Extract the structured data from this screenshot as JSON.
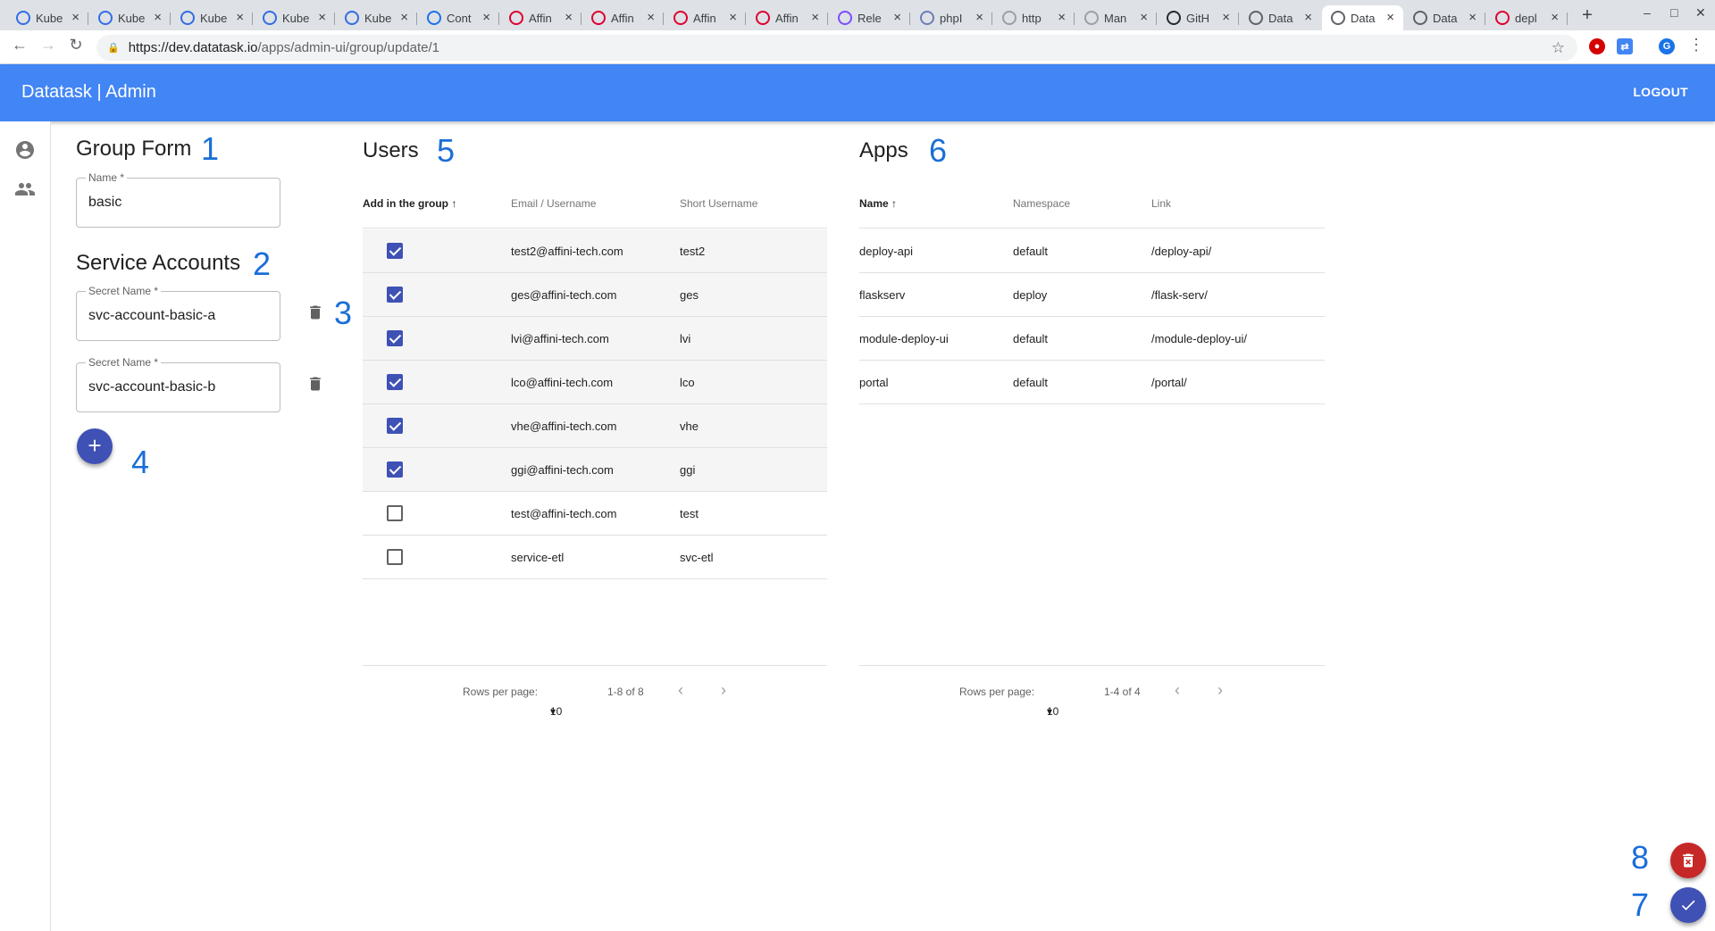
{
  "browser": {
    "tabs": [
      {
        "label": "Kube",
        "icon": "kubernetes-icon",
        "color": "#326ce5"
      },
      {
        "label": "Kube",
        "icon": "kubernetes-icon",
        "color": "#326ce5"
      },
      {
        "label": "Kube",
        "icon": "kubernetes-icon",
        "color": "#326ce5"
      },
      {
        "label": "Kube",
        "icon": "kubernetes-icon",
        "color": "#326ce5"
      },
      {
        "label": "Kube",
        "icon": "kubernetes-icon",
        "color": "#326ce5"
      },
      {
        "label": "Cont",
        "icon": "code-icon",
        "color": "#1a73e8"
      },
      {
        "label": "Affin",
        "icon": "angular-icon",
        "color": "#dd0031"
      },
      {
        "label": "Affin",
        "icon": "angular-icon",
        "color": "#dd0031"
      },
      {
        "label": "Affin",
        "icon": "angular-icon",
        "color": "#dd0031"
      },
      {
        "label": "Affin",
        "icon": "angular-icon",
        "color": "#dd0031"
      },
      {
        "label": "Rele",
        "icon": "release-icon",
        "color": "#7c4dff"
      },
      {
        "label": "phpI",
        "icon": "php-icon",
        "color": "#6c7eb7"
      },
      {
        "label": "http",
        "icon": "globe-icon",
        "color": "#9aa0a6"
      },
      {
        "label": "Man",
        "icon": "globe-icon",
        "color": "#9aa0a6"
      },
      {
        "label": "GitH",
        "icon": "github-icon",
        "color": "#24292e"
      },
      {
        "label": "Data",
        "icon": "share-icon",
        "color": "#5f6368"
      },
      {
        "label": "Data",
        "icon": "share-icon",
        "color": "#5f6368"
      },
      {
        "label": "Data",
        "icon": "share-icon",
        "color": "#5f6368"
      },
      {
        "label": "depl",
        "icon": "angular-icon",
        "color": "#dd0031"
      }
    ],
    "active_tab": 16,
    "url_host": "https://dev.datatask.io",
    "url_path": "/apps/admin-ui/group/update/1",
    "profile_initial": "G"
  },
  "app": {
    "title": "Datatask | Admin",
    "logout_label": "LOGOUT",
    "primary_color": "#4285f4",
    "accent_color": "#3f51b5",
    "danger_color": "#c62828"
  },
  "annotations": [
    "1",
    "2",
    "3",
    "4",
    "5",
    "6",
    "7",
    "8"
  ],
  "group_form": {
    "title": "Group Form",
    "name_label": "Name *",
    "name_value": "basic"
  },
  "service_accounts": {
    "title": "Service Accounts",
    "items": [
      {
        "label": "Secret Name *",
        "value": "svc-account-basic-a"
      },
      {
        "label": "Secret Name *",
        "value": "svc-account-basic-b"
      }
    ]
  },
  "users": {
    "title": "Users",
    "columns": [
      "Add in the group",
      "Email / Username",
      "Short Username"
    ],
    "rows": [
      {
        "checked": true,
        "email": "test2@affini-tech.com",
        "short": "test2"
      },
      {
        "checked": true,
        "email": "ges@affini-tech.com",
        "short": "ges"
      },
      {
        "checked": true,
        "email": "lvi@affini-tech.com",
        "short": "lvi"
      },
      {
        "checked": true,
        "email": "lco@affini-tech.com",
        "short": "lco"
      },
      {
        "checked": true,
        "email": "vhe@affini-tech.com",
        "short": "vhe"
      },
      {
        "checked": true,
        "email": "ggi@affini-tech.com",
        "short": "ggi"
      },
      {
        "checked": false,
        "email": "test@affini-tech.com",
        "short": "test"
      },
      {
        "checked": false,
        "email": "service-etl",
        "short": "svc-etl"
      }
    ],
    "rows_per_page_label": "Rows per page:",
    "rows_per_page": "10",
    "range": "1-8 of 8"
  },
  "apps": {
    "title": "Apps",
    "columns": [
      "Name",
      "Namespace",
      "Link"
    ],
    "rows": [
      {
        "name": "deploy-api",
        "namespace": "default",
        "link": "/deploy-api/"
      },
      {
        "name": "flaskserv",
        "namespace": "deploy",
        "link": "/flask-serv/"
      },
      {
        "name": "module-deploy-ui",
        "namespace": "default",
        "link": "/module-deploy-ui/"
      },
      {
        "name": "portal",
        "namespace": "default",
        "link": "/portal/"
      }
    ],
    "rows_per_page_label": "Rows per page:",
    "rows_per_page": "10",
    "range": "1-4 of 4"
  }
}
